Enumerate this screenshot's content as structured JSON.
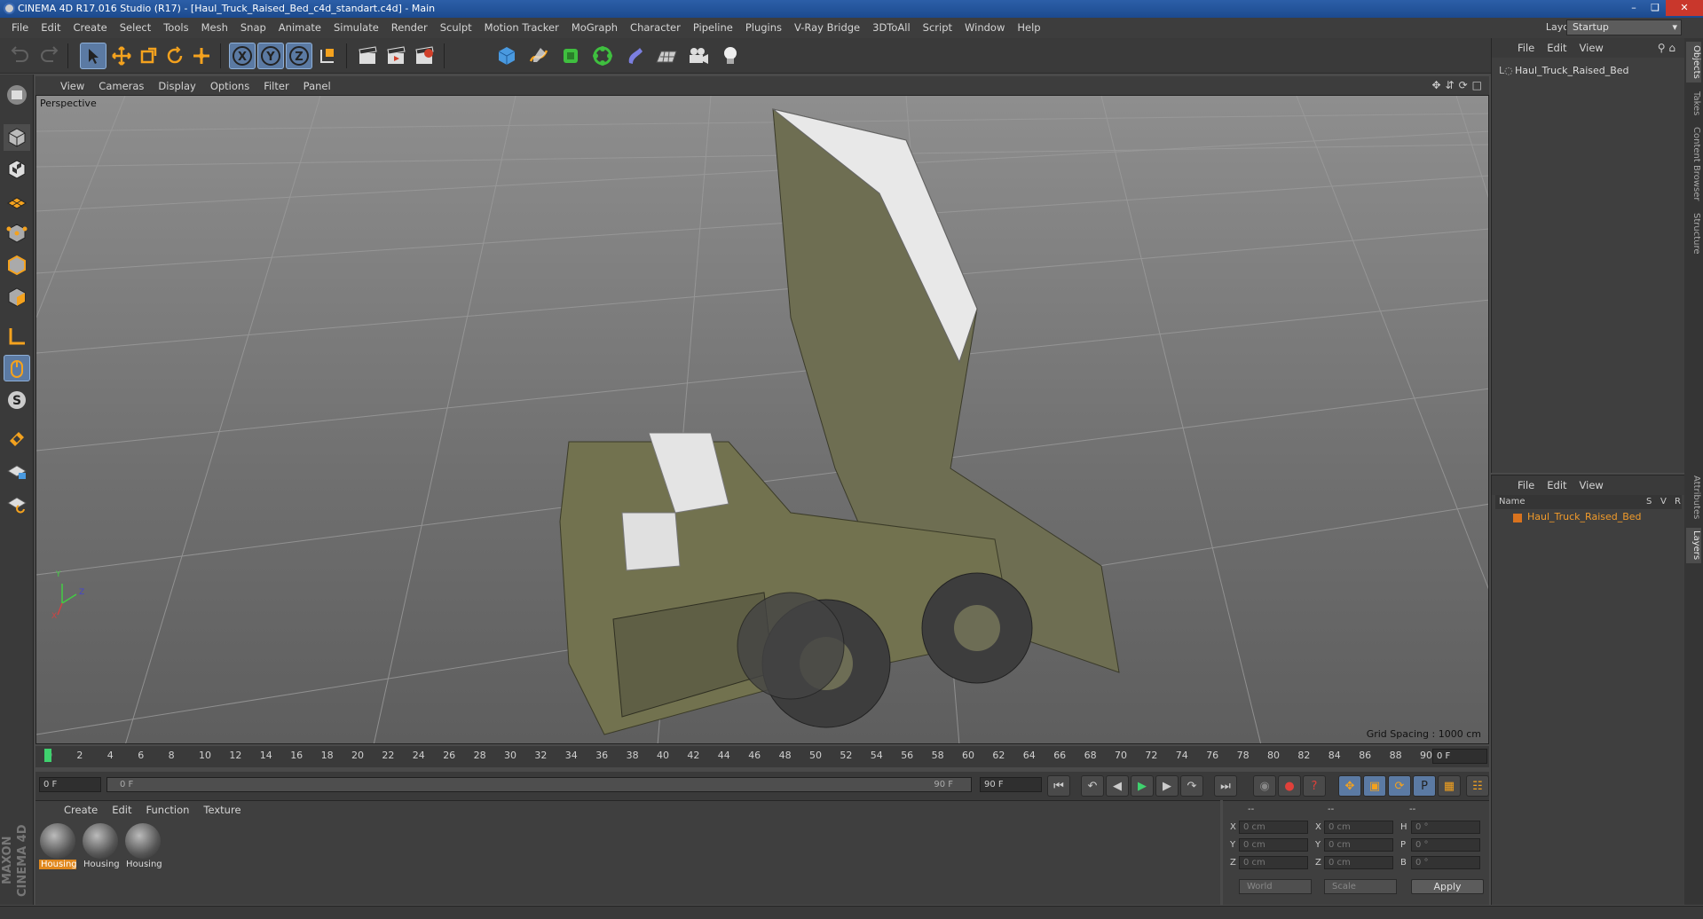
{
  "window": {
    "title": "CINEMA 4D R17.016 Studio (R17) - [Haul_Truck_Raised_Bed_c4d_standart.c4d] - Main"
  },
  "menubar": {
    "items": [
      "File",
      "Edit",
      "Create",
      "Select",
      "Tools",
      "Mesh",
      "Snap",
      "Animate",
      "Simulate",
      "Render",
      "Sculpt",
      "Motion Tracker",
      "MoGraph",
      "Character",
      "Pipeline",
      "Plugins",
      "V-Ray Bridge",
      "3DToAll",
      "Script",
      "Window",
      "Help"
    ],
    "layout_label": "Layout:",
    "layout_value": "Startup"
  },
  "viewport": {
    "menu": [
      "View",
      "Cameras",
      "Display",
      "Options",
      "Filter",
      "Panel"
    ],
    "label": "Perspective",
    "grid_spacing": "Grid Spacing : 1000 cm",
    "axis": {
      "x": "X",
      "y": "Y",
      "z": "Z"
    }
  },
  "timeline": {
    "ticks": [
      "0",
      "2",
      "4",
      "6",
      "8",
      "10",
      "12",
      "14",
      "16",
      "18",
      "20",
      "22",
      "24",
      "26",
      "28",
      "30",
      "32",
      "34",
      "36",
      "38",
      "40",
      "42",
      "44",
      "46",
      "48",
      "50",
      "52",
      "54",
      "56",
      "58",
      "60",
      "62",
      "64",
      "66",
      "68",
      "70",
      "72",
      "74",
      "76",
      "78",
      "80",
      "82",
      "84",
      "86",
      "88",
      "90"
    ],
    "current_frame": "0 F"
  },
  "transport": {
    "start_field": "0 F",
    "slider_start": "0 F",
    "slider_end": "90 F",
    "end_field": "90 F"
  },
  "materials": {
    "menu": [
      "Create",
      "Edit",
      "Function",
      "Texture"
    ],
    "items": [
      "Housing",
      "Housing",
      "Housing"
    ]
  },
  "coordinates": {
    "header": [
      "--",
      "--",
      "--"
    ],
    "pos_labels": [
      "X",
      "Y",
      "Z"
    ],
    "pos_values": [
      "0 cm",
      "0 cm",
      "0 cm"
    ],
    "size_labels": [
      "X",
      "Y",
      "Z"
    ],
    "size_values": [
      "0 cm",
      "0 cm",
      "0 cm"
    ],
    "rot_labels": [
      "H",
      "P",
      "B"
    ],
    "rot_values": [
      "0 °",
      "0 °",
      "0 °"
    ],
    "mode_dropdown": "World",
    "size_dropdown": "Scale",
    "apply_label": "Apply"
  },
  "objects_panel": {
    "menu": [
      "File",
      "Edit",
      "View"
    ],
    "object_name": "Haul_Truck_Raised_Bed"
  },
  "layers_panel": {
    "menu": [
      "File",
      "Edit",
      "View"
    ],
    "columns": [
      "Name",
      "S",
      "V",
      "R"
    ],
    "layer_name": "Haul_Truck_Raised_Bed",
    "layer_color": "#d9731e"
  },
  "side_tabs": {
    "top": [
      "Objects",
      "Takes",
      "Content Browser",
      "Structure"
    ],
    "bottom": [
      "Attributes",
      "Layers"
    ]
  },
  "branding": {
    "logo_text": "MAXON CINEMA 4D"
  },
  "colors": {
    "accent": "#5b7aa3",
    "selection": "#e0881e",
    "titlebar": "#2c5fa8"
  }
}
